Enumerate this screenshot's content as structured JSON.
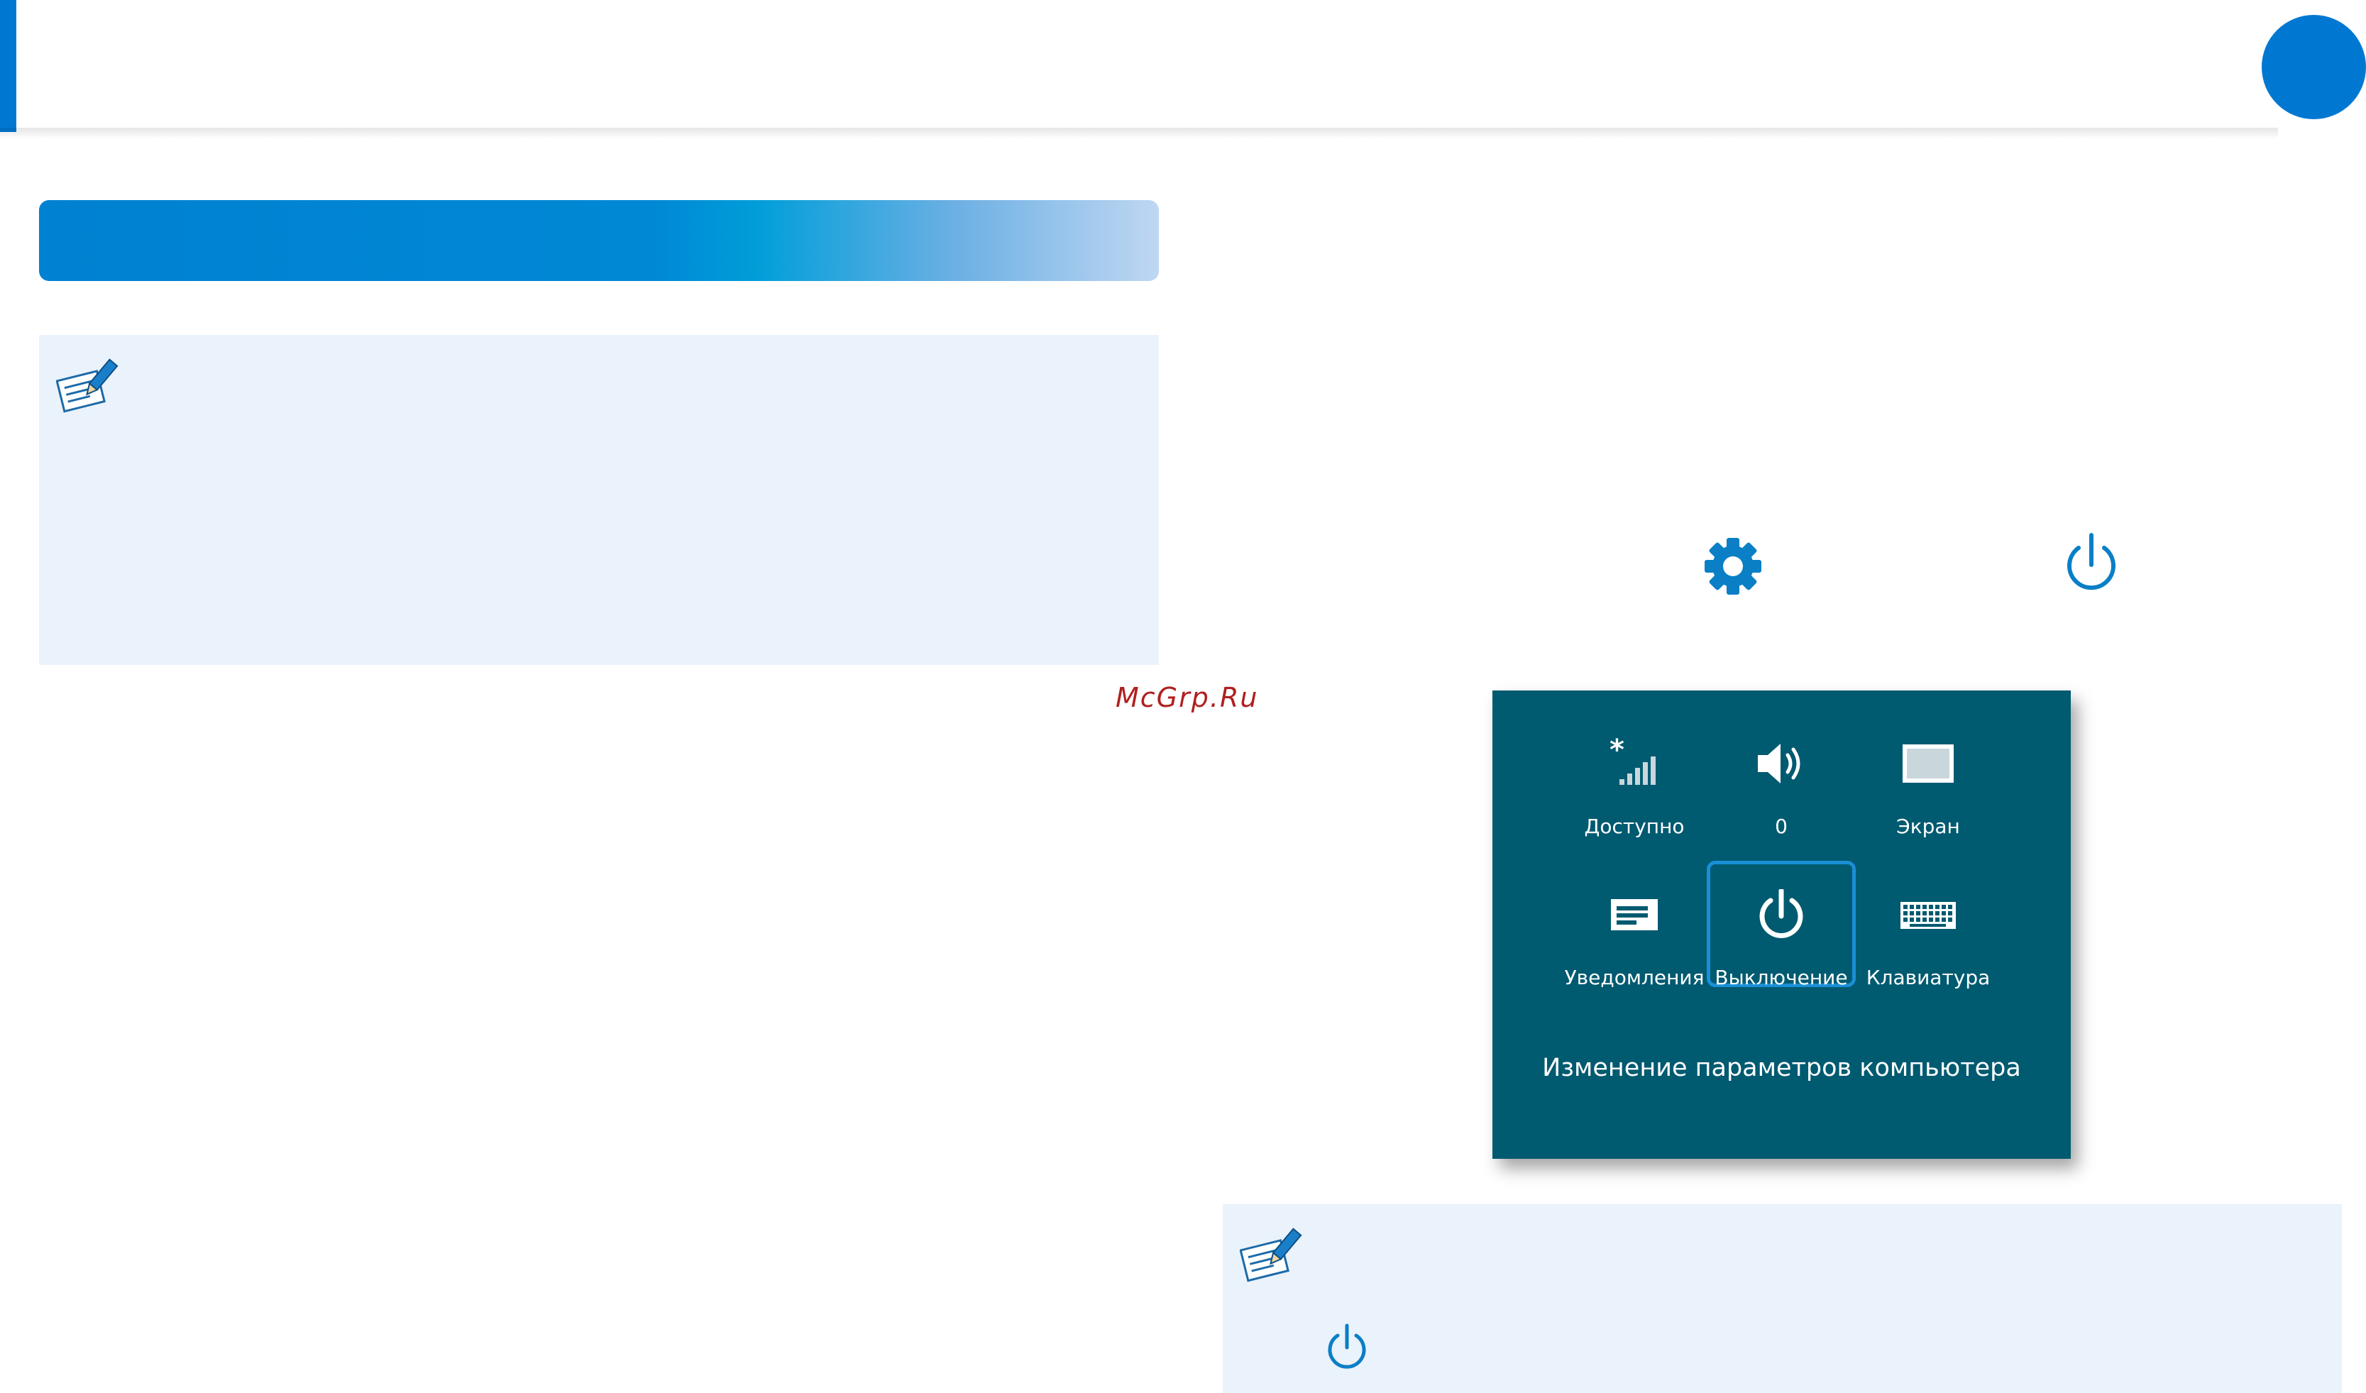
{
  "watermark": "McGrp.Ru",
  "settings_panel": {
    "tiles": [
      {
        "icon": "wifi-available-icon",
        "label": "Доступно"
      },
      {
        "icon": "speaker-icon",
        "label": "0"
      },
      {
        "icon": "screen-icon",
        "label": "Экран"
      },
      {
        "icon": "notifications-icon",
        "label": "Уведомления"
      },
      {
        "icon": "power-icon",
        "label": "Выключение",
        "selected": true
      },
      {
        "icon": "keyboard-icon",
        "label": "Клавиатура"
      }
    ],
    "change_settings_label": "Изменение параметров компьютера"
  },
  "standalone_icons": [
    "gear-icon",
    "power-icon"
  ],
  "colors": {
    "accent": "#0078d2",
    "panel_teal": "#005a70",
    "note_bg": "#eaf2fb",
    "icon_blue": "#0a7fc6",
    "selected_border": "#1a8fd6"
  }
}
